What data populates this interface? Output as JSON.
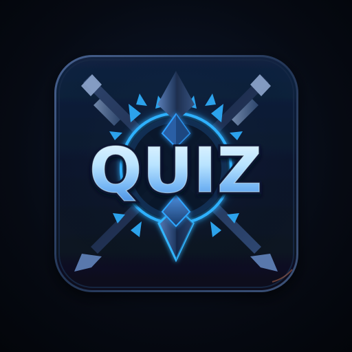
{
  "app_icon": {
    "label": "QUIZ",
    "colors": {
      "background_dark": "#03050a",
      "tile_dark": "#08111f",
      "tile_mid": "#0d1c33",
      "tile_border": "#2f4163",
      "accent_blue": "#2ea8ff",
      "accent_glow": "#59c7ff",
      "text_top": "#dff4ff",
      "text_bottom": "#4f98ea",
      "text_stroke": "#0a1730",
      "steel_light": "#8ca4cb",
      "steel_dark": "#253553"
    }
  }
}
